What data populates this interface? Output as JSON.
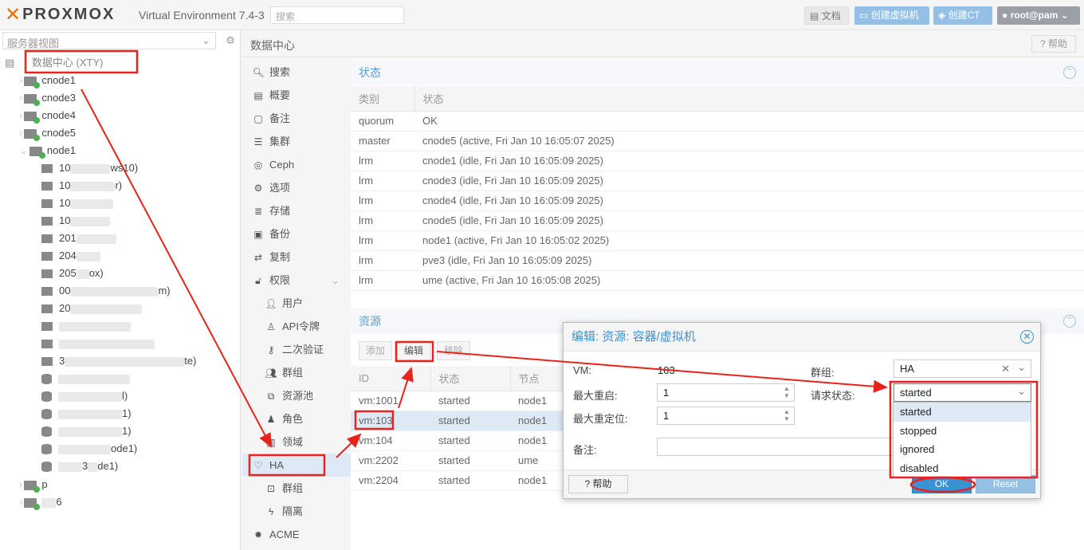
{
  "topbar": {
    "logo_text": "PROXMOX",
    "version": "Virtual Environment 7.4-3",
    "search_placeholder": "搜索",
    "docs_label": "文档",
    "create_vm_label": "创建虚拟机",
    "create_ct_label": "创建CT",
    "user_label": "root@pam"
  },
  "left": {
    "view_selector": "服务器视图",
    "datacenter": "数据中心 (XTY)",
    "nodes": [
      "cnode1",
      "cnode3",
      "cnode4",
      "cnode5",
      "node1"
    ],
    "node1_children": [
      "10",
      "ws10)",
      "10",
      "r)",
      "10",
      "10",
      "201",
      "204",
      "205",
      "ox)",
      "00",
      "m)",
      "20",
      "3",
      "te)",
      "l)",
      "1)",
      "1)",
      "ode1)",
      "3",
      "de1)"
    ],
    "bottom_nodes": [
      "p",
      "6"
    ]
  },
  "header": {
    "title": "数据中心",
    "help": "帮助"
  },
  "menu": {
    "items": [
      {
        "label": "搜索",
        "icon": "search-icon"
      },
      {
        "label": "概要",
        "icon": "book-icon"
      },
      {
        "label": "备注",
        "icon": "note-icon"
      },
      {
        "label": "集群",
        "icon": "server-icon"
      },
      {
        "label": "Ceph",
        "icon": "ceph-icon"
      },
      {
        "label": "选项",
        "icon": "gear-icon"
      },
      {
        "label": "存储",
        "icon": "database-icon"
      },
      {
        "label": "备份",
        "icon": "floppy-icon"
      },
      {
        "label": "复制",
        "icon": "retweet-icon"
      },
      {
        "label": "权限",
        "icon": "unlock-icon"
      },
      {
        "label": "用户",
        "icon": "user-icon"
      },
      {
        "label": "API令牌",
        "icon": "user-o-icon"
      },
      {
        "label": "二次验证",
        "icon": "key-icon"
      },
      {
        "label": "群组",
        "icon": "users-icon"
      },
      {
        "label": "资源池",
        "icon": "tags-icon"
      },
      {
        "label": "角色",
        "icon": "male-icon"
      },
      {
        "label": "领域",
        "icon": "building-icon"
      },
      {
        "label": "HA",
        "icon": "heartbeat-icon"
      },
      {
        "label": "群组",
        "icon": "object-group-icon"
      },
      {
        "label": "隔离",
        "icon": "bolt-icon"
      },
      {
        "label": "ACME",
        "icon": "certificate-icon"
      }
    ]
  },
  "status_panel": {
    "title": "状态",
    "columns": [
      "类别",
      "状态"
    ],
    "rows": [
      [
        "quorum",
        "OK"
      ],
      [
        "master",
        "cnode5 (active, Fri Jan 10 16:05:07 2025)"
      ],
      [
        "lrm",
        "cnode1 (idle, Fri Jan 10 16:05:09 2025)"
      ],
      [
        "lrm",
        "cnode3 (idle, Fri Jan 10 16:05:09 2025)"
      ],
      [
        "lrm",
        "cnode4 (idle, Fri Jan 10 16:05:09 2025)"
      ],
      [
        "lrm",
        "cnode5 (idle, Fri Jan 10 16:05:09 2025)"
      ],
      [
        "lrm",
        "node1 (active, Fri Jan 10 16:05:02 2025)"
      ],
      [
        "lrm",
        "pve3 (idle, Fri Jan 10 16:05:09 2025)"
      ],
      [
        "lrm",
        "ume (active, Fri Jan 10 16:05:08 2025)"
      ]
    ]
  },
  "resource_panel": {
    "title": "资源",
    "add": "添加",
    "edit": "编辑",
    "remove": "移除",
    "columns": [
      "ID",
      "状态",
      "节点"
    ],
    "rows": [
      [
        "vm:1001",
        "started",
        "node1"
      ],
      [
        "vm:103",
        "started",
        "node1"
      ],
      [
        "vm:104",
        "started",
        "node1"
      ],
      [
        "vm:2202",
        "started",
        "ume"
      ],
      [
        "vm:2204",
        "started",
        "node1"
      ]
    ]
  },
  "dialog": {
    "title": "编辑: 资源: 容器/虚拟机",
    "vm_label": "VM:",
    "vm_value": "103",
    "max_restart_label": "最大重启:",
    "max_restart_value": "1",
    "max_relocate_label": "最大重定位:",
    "max_relocate_value": "1",
    "comment_label": "备注:",
    "group_label": "群组:",
    "group_value": "HA",
    "state_label": "请求状态:",
    "state_value": "started",
    "options": [
      "started",
      "stopped",
      "ignored",
      "disabled"
    ],
    "help": "帮助",
    "ok": "OK",
    "reset": "Reset"
  }
}
